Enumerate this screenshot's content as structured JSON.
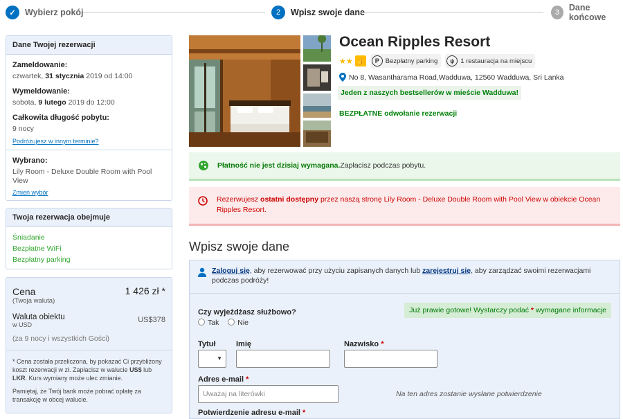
{
  "progress": {
    "step1": {
      "number": "✓",
      "label": "Wybierz pokój"
    },
    "step2": {
      "number": "2",
      "label": "Wpisz swoje dane"
    },
    "step3": {
      "number": "3",
      "label": "Dane końcowe"
    }
  },
  "booking": {
    "header": "Dane Twojej rezerwacji",
    "checkin_label": "Zameldowanie:",
    "checkin_day": "czwartek,",
    "checkin_date": "31 stycznia",
    "checkin_rest": "2019 od 14:00",
    "checkout_label": "Wymeldowanie:",
    "checkout_day": "sobota,",
    "checkout_date": "9 lutego",
    "checkout_rest": "2019 do 12:00",
    "length_label": "Całkowita długość pobytu:",
    "length_value": "9 nocy",
    "other_dates_link": "Podróżujesz w innym terminie?",
    "selected_label": "Wybrano:",
    "selected_value": "Lily Room - Deluxe Double Room with Pool View",
    "change_link": "Zmień wybór"
  },
  "includes": {
    "header": "Twoja rezerwacja obejmuje",
    "items": [
      "Śniadanie",
      "Bezpłatne WiFi",
      "Bezpłatny parking"
    ]
  },
  "price": {
    "label": "Cena",
    "sublabel": "(Twoja waluta)",
    "value": "1 426 zł *",
    "property_currency_label": "Waluta obiektu",
    "property_currency_sub": "w USD",
    "property_currency_value": "US$378",
    "note_nights": "(za 9 nocy i wszystkich Gości)",
    "disclaimer_a": "* Cena została przeliczona, by pokazać Ci przybliżony koszt rezerwacji w zł. Zapłacisz w walucie",
    "disclaimer_usd": "US$",
    "disclaimer_or": "lub",
    "disclaimer_lkr": "LKR",
    "disclaimer_b": ". Kurs wymiany może ulec zmianie.",
    "disclaimer2": "Pamiętaj, że Twój bank może pobrać opłatę za transakcję w obcej walucie."
  },
  "hotel": {
    "name": "Ocean Ripples Resort",
    "stars": "★★",
    "parking": "Bezpłatny parking",
    "restaurant": "1 restauracja na miejscu",
    "address": "No 8, Wasantharama Road,Wadduwa, 12560 Wadduwa, Sri Lanka",
    "bestseller": "Jeden z naszych bestsellerów w mieście Wadduwa!",
    "free_cancel": "BEZPŁATNE odwołanie rezerwacji"
  },
  "alerts": {
    "payment_bold": "Płatność nie jest dzisiaj wymagana.",
    "payment_rest": " Zapłacisz podczas pobytu.",
    "last_a": "Rezerwujesz ",
    "last_bold": "ostatni dostępny",
    "last_b": " przez naszą stronę Lily Room - Deluxe Double Room with Pool View w obiekcie Ocean Ripples Resort."
  },
  "form": {
    "title": "Wpisz swoje dane",
    "signin_link": "Zaloguj się",
    "signin_mid": ", aby rezerwować przy użyciu zapisanych danych lub ",
    "register_link": "zarejestruj się",
    "signin_end": ", aby zarządzać swoimi rezerwacjami podczas podróży!",
    "business_question": "Czy wyjeżdżasz służbowo?",
    "yes": "Tak",
    "no": "Nie",
    "almost_a": "Już prawie gotowe! Wystarczy podać ",
    "almost_star": "*",
    "almost_b": " wymagane informacje",
    "title_label": "Tytuł",
    "firstname_label": "Imię",
    "lastname_label": "Nazwisko",
    "required": "*",
    "email_label": "Adres e-mail",
    "email_placeholder": "Uważaj na literówki",
    "email_hint": "Na ten adres zostanie wysłane potwierdzenie",
    "confirm_label": "Potwierdzenie adresu e-mail"
  },
  "colors": {
    "brand": "#0071c2",
    "green": "#008009",
    "red": "#cc0000",
    "panel": "#ebf1fa"
  }
}
